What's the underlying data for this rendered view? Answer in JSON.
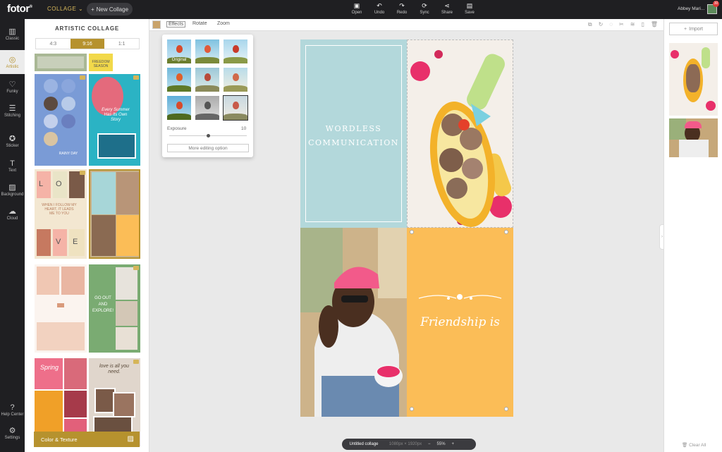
{
  "topbar": {
    "logo": "fotor",
    "logo_mark": "®",
    "collage_menu": "COLLAGE",
    "new_collage": "New Collage",
    "tools": [
      {
        "label": "Open",
        "icon": "open-icon"
      },
      {
        "label": "Undo",
        "icon": "undo-icon"
      },
      {
        "label": "Redo",
        "icon": "redo-icon"
      },
      {
        "label": "Sync",
        "icon": "sync-icon"
      },
      {
        "label": "Share",
        "icon": "share-icon"
      },
      {
        "label": "Save",
        "icon": "save-icon"
      }
    ],
    "user_name": "Abbey Mari...",
    "notification_count": "30"
  },
  "leftnav": [
    {
      "label": "Classic",
      "icon": "classic-icon"
    },
    {
      "label": "Artistic",
      "icon": "artistic-icon",
      "active": true
    },
    {
      "label": "Funky",
      "icon": "funky-icon"
    },
    {
      "label": "Stitching",
      "icon": "stitching-icon"
    },
    {
      "label": "Sticker",
      "icon": "sticker-icon"
    },
    {
      "label": "Text",
      "icon": "text-icon"
    },
    {
      "label": "Background",
      "icon": "background-icon"
    },
    {
      "label": "Cloud",
      "icon": "cloud-icon"
    },
    {
      "label": "Help Center",
      "icon": "help-icon"
    },
    {
      "label": "Settings",
      "icon": "settings-icon"
    }
  ],
  "panel": {
    "title": "ARTISTIC COLLAGE",
    "ratios": [
      "4:3",
      "9:16",
      "1:1"
    ],
    "active_ratio": "9:16",
    "template_texts": {
      "freedom": "FREEDOM SEASON",
      "rainy": "RAINY DAY",
      "every": "Every Summer Has Its Own Story",
      "love_l": "L",
      "love_o": "O",
      "love_v": "V",
      "love_e": "E",
      "follow": "WHEN I FOLLOW MY HEART, IT LEADS ME TO YOU",
      "goout": "GO OUT AND EXPLORE!",
      "spring": "Spring",
      "loveisall": "love is all you need."
    },
    "color_texture": "Color & Texture"
  },
  "editbar": {
    "tabs": [
      "Effects",
      "Rotate",
      "Zoom"
    ],
    "active_tab": "Effects"
  },
  "effects": {
    "original_label": "Original",
    "exposure_label": "Exposure",
    "exposure_value": "10",
    "exposure_level": 0.5,
    "more_button": "More editing option"
  },
  "canvas": {
    "text1_line1": "WORDLESS",
    "text1_line2": "COMMUNICATION",
    "text2": "Friendship is"
  },
  "status": {
    "title": "Untitled collage",
    "dims": "1080px × 1920px",
    "zoom": "55%",
    "minus": "−",
    "plus": "+"
  },
  "rightpanel": {
    "import": "Import",
    "clear_all": "Clear All"
  },
  "colors": {
    "accent": "#b6922e",
    "teal": "#b3d8db",
    "orange": "#fbbd57",
    "dark": "#1f1f22"
  }
}
